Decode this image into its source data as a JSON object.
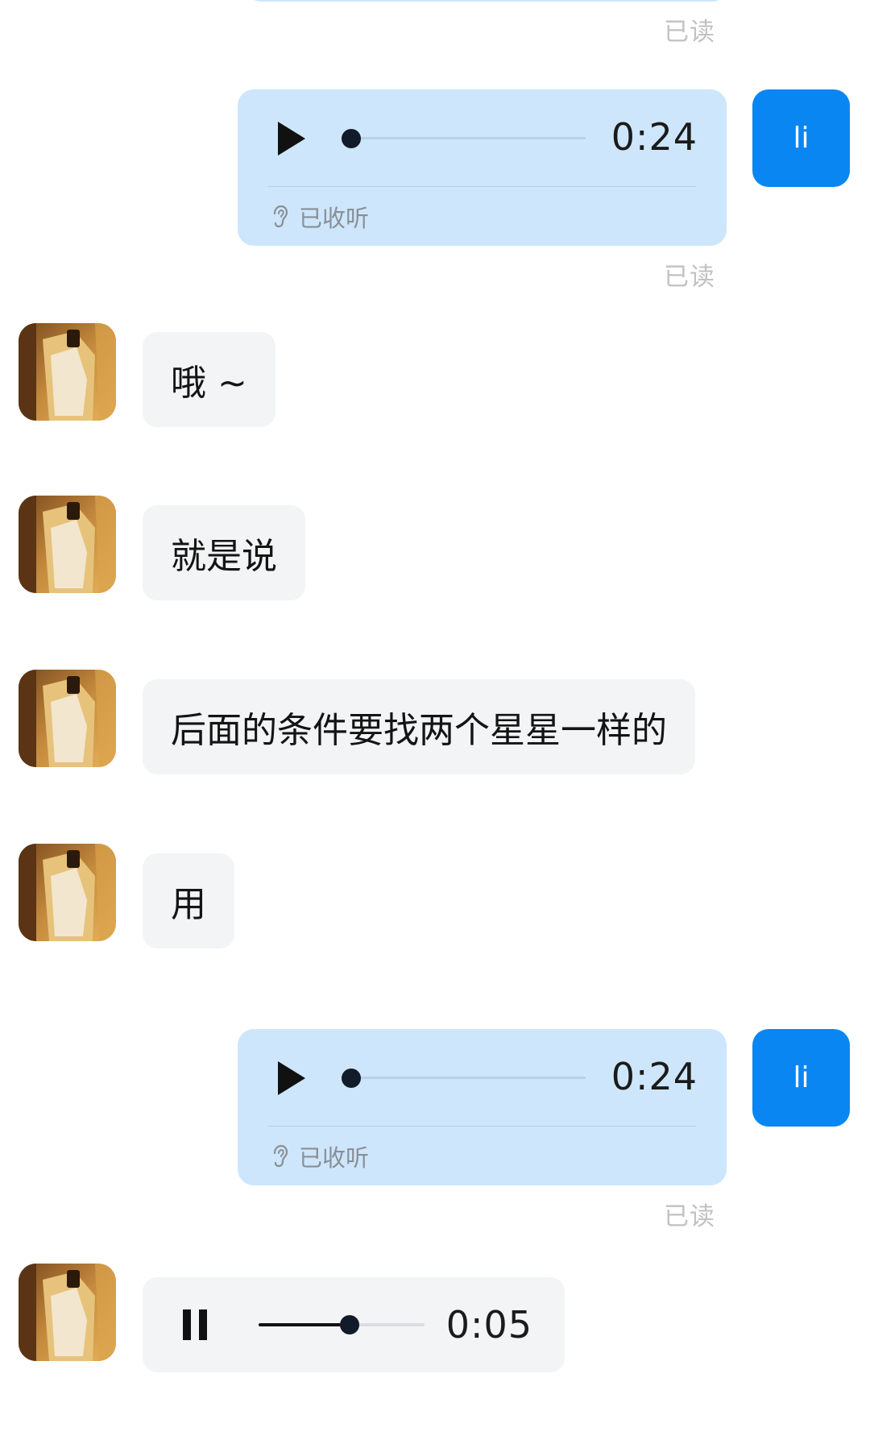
{
  "messages": [
    {
      "type": "read_receipt",
      "text": "已读"
    },
    {
      "type": "outgoing_voice",
      "duration": "0:24",
      "status": "已收听",
      "read": "已读",
      "avatar_text": "li"
    },
    {
      "type": "incoming_text",
      "text": "哦 ~"
    },
    {
      "type": "incoming_text",
      "text": "就是说"
    },
    {
      "type": "incoming_text",
      "text": "后面的条件要找两个星星一样的"
    },
    {
      "type": "incoming_text",
      "text": "用"
    },
    {
      "type": "outgoing_voice",
      "duration": "0:24",
      "status": "已收听",
      "read": "已读",
      "avatar_text": "li"
    },
    {
      "type": "incoming_voice",
      "duration": "0:05",
      "state": "playing",
      "progress": 0.55
    }
  ],
  "colors": {
    "outgoing_bubble": "#cde6fb",
    "incoming_bubble": "#f3f4f6",
    "my_avatar": "#0a86f2",
    "read_receipt": "#c2c2c2"
  },
  "icons": {
    "play": "play-icon",
    "pause": "pause-icon",
    "listened": "ear-icon",
    "contact_avatar": "contact-avatar-photo"
  }
}
